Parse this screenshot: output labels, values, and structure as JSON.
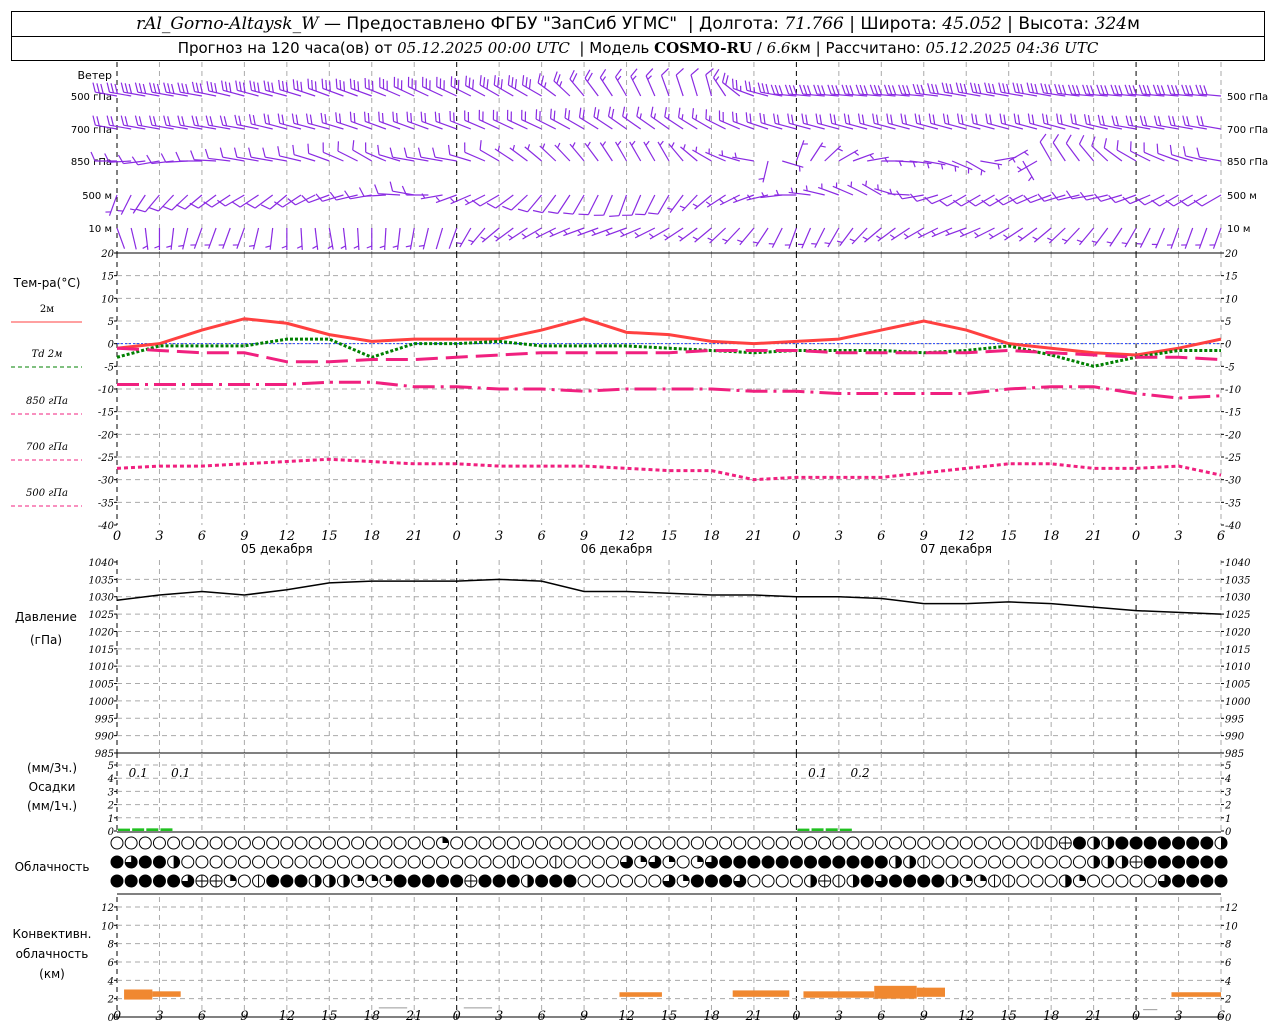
{
  "header": {
    "station": "rAl_Gorno-Altaysk_W",
    "provider": " — Предоставлено ФГБУ \"ЗапСиб УГМС\" ",
    "sep": " | ",
    "lon_label": "Долгота: ",
    "lon": "71.766",
    "lat_label": "Широта: ",
    "lat": "45.052",
    "alt_label": "Высота: ",
    "alt": "324",
    "alt_unit": "м",
    "forecast_label": "Прогноз на 120 часа(ов) от ",
    "forecast_start": "05.12.2025 00:00 UTC",
    "model_label": "  | Модель ",
    "model": "COSMO-RU",
    "res_sep": " / ",
    "res": "6.6",
    "res_unit": "км",
    "calc_label": " | Рассчитано: ",
    "calc_time": "05.12.2025 04:36 UTC"
  },
  "chart_data": [
    {
      "type": "wind-barbs",
      "title": "Ветер",
      "levels": [
        "500 гПа",
        "700 гПа",
        "850 гПа",
        "500 м",
        "10 м"
      ],
      "hours": [
        0,
        3,
        6,
        9,
        12,
        15,
        18,
        21,
        24,
        27,
        30,
        33,
        36,
        39,
        42,
        45,
        48,
        51,
        54,
        57,
        60,
        63,
        66,
        69,
        72,
        75,
        78
      ],
      "direction": [
        [
          280,
          280,
          280,
          285,
          285,
          290,
          290,
          295,
          295,
          300,
          300,
          320,
          330,
          340,
          345,
          290,
          275,
          275,
          275,
          275,
          280,
          280,
          280,
          275,
          275,
          275,
          275
        ],
        [
          280,
          280,
          280,
          280,
          285,
          285,
          290,
          290,
          290,
          295,
          295,
          300,
          305,
          305,
          300,
          290,
          285,
          285,
          285,
          285,
          285,
          285,
          285,
          285,
          280,
          280,
          280
        ],
        [
          270,
          260,
          270,
          280,
          280,
          290,
          300,
          280,
          280,
          300,
          310,
          320,
          330,
          330,
          300,
          280,
          20,
          60,
          90,
          100,
          120,
          60,
          330,
          320,
          300,
          290,
          280
        ],
        [
          200,
          220,
          230,
          240,
          230,
          250,
          260,
          280,
          250,
          240,
          220,
          210,
          200,
          210,
          230,
          250,
          270,
          290,
          300,
          260,
          240,
          240,
          250,
          260,
          250,
          240,
          240
        ],
        [
          160,
          180,
          200,
          200,
          180,
          170,
          180,
          190,
          200,
          230,
          240,
          250,
          250,
          240,
          230,
          220,
          200,
          210,
          230,
          240,
          250,
          240,
          230,
          220,
          210,
          200,
          200
        ]
      ],
      "speed": [
        [
          30,
          30,
          30,
          30,
          28,
          28,
          28,
          30,
          30,
          30,
          28,
          22,
          15,
          12,
          12,
          25,
          30,
          30,
          30,
          30,
          32,
          32,
          30,
          30,
          30,
          30,
          30
        ],
        [
          20,
          20,
          22,
          22,
          22,
          20,
          20,
          22,
          22,
          22,
          20,
          20,
          18,
          15,
          15,
          20,
          22,
          22,
          22,
          22,
          22,
          22,
          22,
          22,
          22,
          22,
          22
        ],
        [
          12,
          10,
          10,
          12,
          12,
          10,
          8,
          10,
          10,
          8,
          6,
          5,
          5,
          5,
          5,
          5,
          3,
          3,
          3,
          3,
          3,
          5,
          8,
          8,
          10,
          10,
          12
        ],
        [
          5,
          8,
          10,
          8,
          8,
          8,
          10,
          10,
          5,
          8,
          8,
          8,
          8,
          8,
          5,
          5,
          5,
          5,
          5,
          8,
          8,
          10,
          10,
          10,
          10,
          10,
          10
        ],
        [
          2,
          3,
          3,
          3,
          3,
          3,
          3,
          3,
          2,
          5,
          5,
          5,
          5,
          5,
          5,
          5,
          5,
          5,
          5,
          5,
          5,
          5,
          5,
          5,
          5,
          5,
          5
        ]
      ],
      "color": "#8a2be2"
    },
    {
      "type": "line",
      "title": "Тем-ра(°С)",
      "ylim": [
        -40,
        20
      ],
      "yticks": [
        20,
        15,
        10,
        5,
        0,
        -5,
        -10,
        -15,
        -20,
        -25,
        -30,
        -35,
        -40
      ],
      "hours": [
        0,
        3,
        6,
        9,
        12,
        15,
        18,
        21,
        24,
        27,
        30,
        33,
        36,
        39,
        42,
        45,
        48,
        51,
        54,
        57,
        60,
        63,
        66,
        69,
        72,
        75,
        78
      ],
      "series": [
        {
          "name": "2м",
          "color": "#ff4040",
          "style": "solid",
          "values": [
            -1,
            0,
            3,
            5.5,
            4.5,
            2,
            0.5,
            1,
            1,
            1,
            3,
            5.5,
            2.5,
            2,
            0.5,
            0,
            0.5,
            1,
            3,
            5,
            3,
            0,
            -1,
            -2,
            -2.5,
            -1,
            1
          ]
        },
        {
          "name": "Td 2м",
          "color": "#008000",
          "style": "dotted",
          "values": [
            -3,
            -0.5,
            -0.5,
            -0.5,
            1,
            1,
            -3,
            0,
            0,
            0.5,
            -0.5,
            -0.5,
            -0.5,
            -1,
            -1.5,
            -2,
            -1.5,
            -1.5,
            -1.5,
            -2,
            -1.5,
            -0.5,
            -2.5,
            -5,
            -3,
            -1.5,
            -1.5
          ]
        },
        {
          "name": "850 гПа",
          "color": "#f0207f",
          "style": "dash",
          "values": [
            -1,
            -1.5,
            -2,
            -2,
            -4,
            -4,
            -3.5,
            -3.5,
            -3,
            -2.5,
            -2,
            -2,
            -2,
            -2,
            -1.5,
            -1.5,
            -1.5,
            -2,
            -2,
            -2,
            -2,
            -1.5,
            -2,
            -2.5,
            -3,
            -3,
            -3.5
          ]
        },
        {
          "name": "700 гПа",
          "color": "#f0207f",
          "style": "dashdot",
          "values": [
            -9,
            -9,
            -9,
            -9,
            -9,
            -8.5,
            -8.5,
            -9.5,
            -9.5,
            -10,
            -10,
            -10.5,
            -10,
            -10,
            -10,
            -10.5,
            -10.5,
            -11,
            -11,
            -11,
            -11,
            -10,
            -9.5,
            -9.5,
            -11,
            -12,
            -11.5
          ]
        },
        {
          "name": "500 гПа",
          "color": "#f0207f",
          "style": "dot",
          "values": [
            -27.5,
            -27,
            -27,
            -26.5,
            -26,
            -25.5,
            -26,
            -26.5,
            -26.5,
            -27,
            -27,
            -27,
            -27.5,
            -28,
            -28,
            -30,
            -29.5,
            -29.5,
            -29.5,
            -28.5,
            -27.5,
            -26.5,
            -26.5,
            -27.5,
            -27.5,
            -27,
            -29
          ]
        }
      ],
      "xticks": [
        "0",
        "3",
        "6",
        "9",
        "12",
        "15",
        "18",
        "21",
        "0",
        "3",
        "6",
        "9",
        "12",
        "15",
        "18",
        "21",
        "0",
        "3",
        "6",
        "9",
        "12",
        "15",
        "18",
        "21",
        "0",
        "3",
        "6"
      ],
      "days": [
        "05 декабря",
        "06 декабря",
        "07 декабря"
      ]
    },
    {
      "type": "line",
      "title": "Давление",
      "unit": "(гПа)",
      "ylim": [
        985,
        1040
      ],
      "yticks": [
        1040,
        1035,
        1030,
        1025,
        1020,
        1015,
        1010,
        1005,
        1000,
        995,
        990,
        985
      ],
      "hours": [
        0,
        3,
        6,
        9,
        12,
        15,
        18,
        21,
        24,
        27,
        30,
        33,
        36,
        39,
        42,
        45,
        48,
        51,
        54,
        57,
        60,
        63,
        66,
        69,
        72,
        75,
        78
      ],
      "values": [
        1029,
        1030.5,
        1031.5,
        1030.5,
        1032,
        1034,
        1034.5,
        1034.5,
        1034.5,
        1035,
        1034.5,
        1031.5,
        1031.5,
        1031,
        1030.5,
        1030.5,
        1030,
        1030,
        1029.5,
        1028,
        1028,
        1028.5,
        1028,
        1027,
        1026,
        1025.5,
        1025
      ],
      "color": "#000000"
    },
    {
      "type": "bar",
      "title": "Осадки",
      "unit_top": "(мм/3ч.)",
      "unit_bottom": "(мм/1ч.)",
      "ylim": [
        0,
        5
      ],
      "yticks": [
        5,
        4,
        3,
        2,
        1,
        0
      ],
      "hours": [
        1,
        2,
        3,
        4,
        49,
        50,
        51,
        52
      ],
      "values": [
        0.03,
        0.05,
        0.05,
        0.05,
        0.03,
        0.05,
        0.05,
        0.03
      ],
      "labels": [
        {
          "hour": 1.5,
          "text": "0.1"
        },
        {
          "hour": 4.5,
          "text": "0.1"
        },
        {
          "hour": 49.5,
          "text": "0.1"
        },
        {
          "hour": 52.5,
          "text": "0.2"
        }
      ],
      "color": "#20c020"
    },
    {
      "type": "cloud-symbols",
      "title": "Облачность",
      "legend": "0 clear, 1 line, 2 quarter, 4 half, 5 half-with-bar, 6 three-quarter, 8 overcast",
      "rows": [
        "00000000000000000000000200000000000000000000000000000000000000000115844888888848",
        "86884000000000000000000000001001000062620268888888888884410000000000044458888888",
        "88888655201888444222888885888488800000062888600004514868888422110004200000688888"
      ]
    },
    {
      "type": "range-bar",
      "title": "Конвективн. облачность",
      "unit": "(км)",
      "ylim": [
        0,
        13
      ],
      "yticks": [
        12,
        10,
        8,
        6,
        4,
        2,
        0
      ],
      "bars": [
        {
          "from": 0.5,
          "to": 2.5,
          "base": 1.9,
          "top": 3.0
        },
        {
          "from": 2.5,
          "to": 4.5,
          "base": 2.2,
          "top": 2.8
        },
        {
          "from": 35.5,
          "to": 38.5,
          "base": 2.2,
          "top": 2.7
        },
        {
          "from": 43.5,
          "to": 47.5,
          "base": 2.2,
          "top": 2.9
        },
        {
          "from": 48.5,
          "to": 53.5,
          "base": 2.1,
          "top": 2.8
        },
        {
          "from": 53.5,
          "to": 56.5,
          "base": 2.0,
          "top": 3.4
        },
        {
          "from": 56.5,
          "to": 58.5,
          "base": 2.2,
          "top": 3.2
        },
        {
          "from": 74.5,
          "to": 78,
          "base": 2.2,
          "top": 2.7
        }
      ],
      "thin": [
        {
          "from": 18.5,
          "to": 20.5,
          "h": 1.0
        },
        {
          "from": 24.5,
          "to": 26.5,
          "h": 1.0
        },
        {
          "from": 72.5,
          "to": 73.5,
          "h": 0.8
        }
      ],
      "color": "#f08830"
    }
  ]
}
